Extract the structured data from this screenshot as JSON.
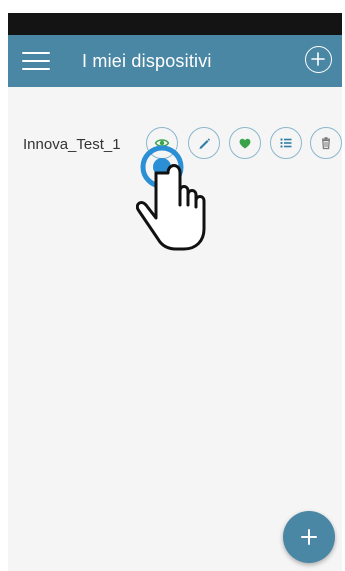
{
  "app_bar": {
    "title": "I miei dispositivi",
    "menu_icon": "hamburger-menu-icon",
    "add_icon": "plus-circle-icon",
    "color": "#4a87a5"
  },
  "devices": [
    {
      "name": "Innova_Test_1",
      "actions": [
        {
          "icon": "eye-icon",
          "color": "#3aa34a"
        },
        {
          "icon": "pencil-icon",
          "color": "#2f7ea6"
        },
        {
          "icon": "heart-icon",
          "color": "#3aa34a"
        },
        {
          "icon": "list-icon",
          "color": "#2f7ea6"
        },
        {
          "icon": "trash-icon",
          "color": "#777777"
        }
      ]
    }
  ],
  "fab": {
    "icon": "plus-icon"
  },
  "tap_indicator": {
    "icon": "pointing-hand-icon",
    "ring_color": "#2b8fd6"
  }
}
